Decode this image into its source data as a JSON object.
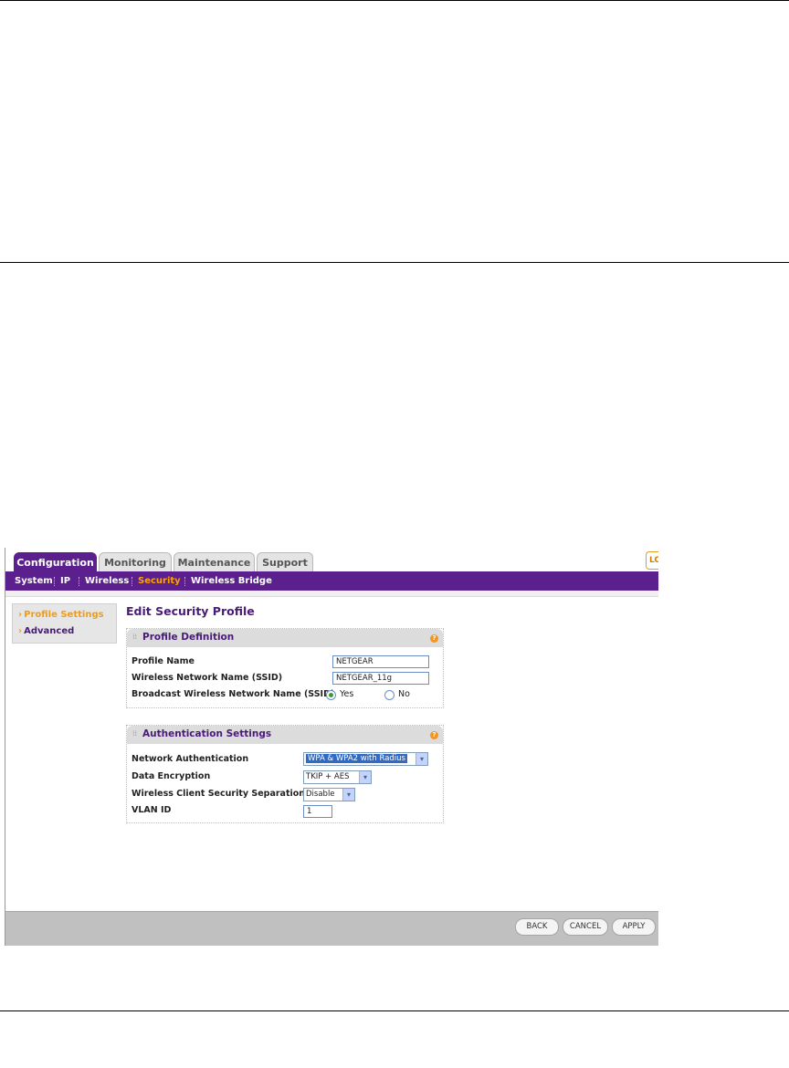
{
  "tabs": [
    {
      "label": "Configuration"
    },
    {
      "label": "Monitoring"
    },
    {
      "label": "Maintenance"
    },
    {
      "label": "Support"
    }
  ],
  "logout_stub": "LO",
  "menu": [
    {
      "label": "System"
    },
    {
      "label": "IP"
    },
    {
      "label": "Wireless"
    },
    {
      "label": "Security"
    },
    {
      "label": "Wireless Bridge"
    }
  ],
  "sidebar": {
    "items": [
      {
        "label": "Profile Settings"
      },
      {
        "label": "Advanced"
      }
    ],
    "arrow": "›"
  },
  "page_title": "Edit Security Profile",
  "profile_definition": {
    "title": "Profile Definition",
    "profile_name_label": "Profile Name",
    "profile_name_value": "NETGEAR",
    "ssid_label": "Wireless Network Name (SSID)",
    "ssid_value": "NETGEAR_11g",
    "broadcast_label": "Broadcast Wireless Network Name (SSID)",
    "yes_label": "Yes",
    "no_label": "No",
    "broadcast_selected": "Yes"
  },
  "authentication_settings": {
    "title": "Authentication Settings",
    "network_auth_label": "Network Authentication",
    "network_auth_value": "WPA & WPA2 with Radius",
    "data_encryption_label": "Data Encryption",
    "data_encryption_value": "TKIP + AES",
    "separation_label": "Wireless Client Security Separation",
    "separation_value": "Disable",
    "vlan_label": "VLAN ID",
    "vlan_value": "1"
  },
  "help_icon": "?",
  "dropdown_glyph": "▾",
  "buttons": {
    "back": "BACK",
    "cancel": "CANCEL",
    "apply": "APPLY"
  },
  "colors": {
    "brand_purple": "#5b1f8e",
    "active_orange": "#ffa200"
  }
}
